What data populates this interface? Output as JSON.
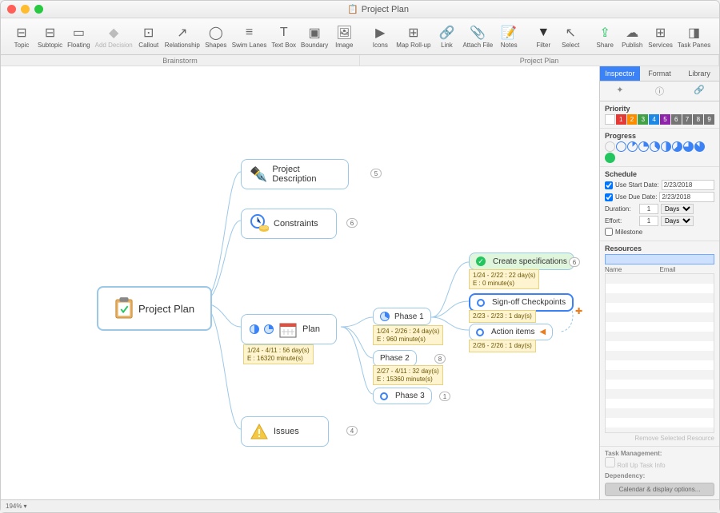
{
  "window": {
    "title": "Project Plan"
  },
  "toolbar": {
    "topic": "Topic",
    "subtopic": "Subtopic",
    "floating": "Floating",
    "add_decision": "Add Decision",
    "callout": "Callout",
    "relationship": "Relationship",
    "shapes": "Shapes",
    "swim_lanes": "Swim Lanes",
    "text_box": "Text Box",
    "boundary": "Boundary",
    "image": "Image",
    "icons": "Icons",
    "map_rollup": "Map Roll-up",
    "link": "Link",
    "attach_file": "Attach File",
    "notes": "Notes",
    "filter": "Filter",
    "select": "Select",
    "share": "Share",
    "publish": "Publish",
    "services": "Services",
    "task_panes": "Task Panes"
  },
  "tabs": {
    "left": "Brainstorm",
    "right": "Project Plan"
  },
  "mindmap": {
    "root": "Project Plan",
    "desc": "Project Description",
    "constraints": "Constraints",
    "plan": "Plan",
    "plan_callout_l1": "1/24 - 4/11 : 56 day(s)",
    "plan_callout_l2": "E : 16320 minute(s)",
    "issues": "Issues",
    "phase1": "Phase 1",
    "phase1_callout_l1": "1/24 - 2/26 : 24 day(s)",
    "phase1_callout_l2": "E : 960 minute(s)",
    "phase2": "Phase 2",
    "phase2_callout_l1": "2/27 - 4/11 : 32 day(s)",
    "phase2_callout_l2": "E : 15360 minute(s)",
    "phase3": "Phase 3",
    "create_spec": "Create specifications",
    "create_spec_c1": "1/24 - 2/22 : 22 day(s)",
    "create_spec_c2": "E : 0 minute(s)",
    "signoff": "Sign-off Checkpoints",
    "signoff_c1": "2/23 - 2/23 : 1 day(s)",
    "action": "Action items",
    "action_c1": "2/26 - 2/26 : 1 day(s)",
    "badges": {
      "desc": "5",
      "constraints": "6",
      "issues": "4",
      "phase2": "8",
      "phase3": "1",
      "spec": "6"
    }
  },
  "sidebar": {
    "tabs": {
      "inspector": "Inspector",
      "format": "Format",
      "library": "Library"
    },
    "priority_label": "Priority",
    "priority": [
      "1",
      "2",
      "3",
      "4",
      "5",
      "6",
      "7",
      "8",
      "9"
    ],
    "priority_colors": [
      "#e53935",
      "#fb8c00",
      "#43a047",
      "#1e88e5",
      "#8e24aa",
      "#757575",
      "#757575",
      "#757575",
      "#757575"
    ],
    "progress_label": "Progress",
    "schedule_label": "Schedule",
    "use_start": "Use Start Date:",
    "use_due": "Use Due Date:",
    "start_date": "2/23/2018",
    "due_date": "2/23/2018",
    "duration": "Duration:",
    "duration_val": "1",
    "days": "Days",
    "effort": "Effort:",
    "effort_val": "1",
    "milestone": "Milestone",
    "resources_label": "Resources",
    "res_name": "Name",
    "res_email": "Email",
    "remove_res": "Remove Selected Resource",
    "task_mgmt": "Task Management:",
    "rollup": "Roll Up Task Info",
    "dependency": "Dependency:",
    "calendar_btn": "Calendar & display options..."
  },
  "status": {
    "zoom": "194%"
  }
}
